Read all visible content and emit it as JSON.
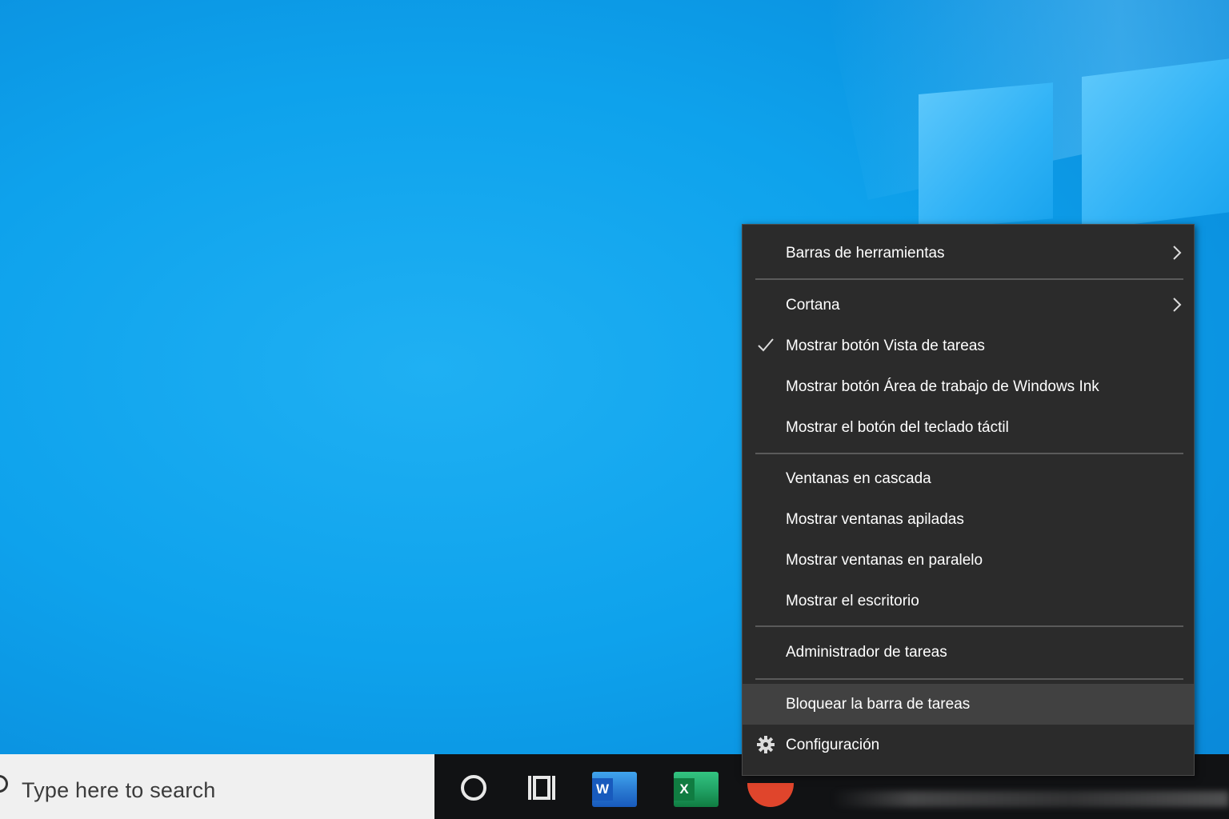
{
  "taskbar": {
    "search_placeholder": "Type here to search",
    "word_badge": "W",
    "excel_badge": "X"
  },
  "context_menu": {
    "items": [
      {
        "label": "Barras de herramientas",
        "submenu": true
      },
      {
        "label": "Cortana",
        "submenu": true
      },
      {
        "label": "Mostrar botón Vista de tareas",
        "checked": true
      },
      {
        "label": "Mostrar botón Área de trabajo de Windows Ink"
      },
      {
        "label": "Mostrar el botón del teclado táctil"
      },
      {
        "label": "Ventanas en cascada"
      },
      {
        "label": "Mostrar ventanas apiladas"
      },
      {
        "label": "Mostrar ventanas en paralelo"
      },
      {
        "label": "Mostrar el escritorio"
      },
      {
        "label": "Administrador de tareas"
      },
      {
        "label": "Bloquear la barra de tareas",
        "highlighted": true
      },
      {
        "label": "Configuración",
        "icon": "gear-icon"
      }
    ]
  },
  "colors": {
    "desktop": "#0ea2ec",
    "menu_bg": "#2b2b2b",
    "menu_hover": "#414141",
    "taskbar": "#111214"
  }
}
